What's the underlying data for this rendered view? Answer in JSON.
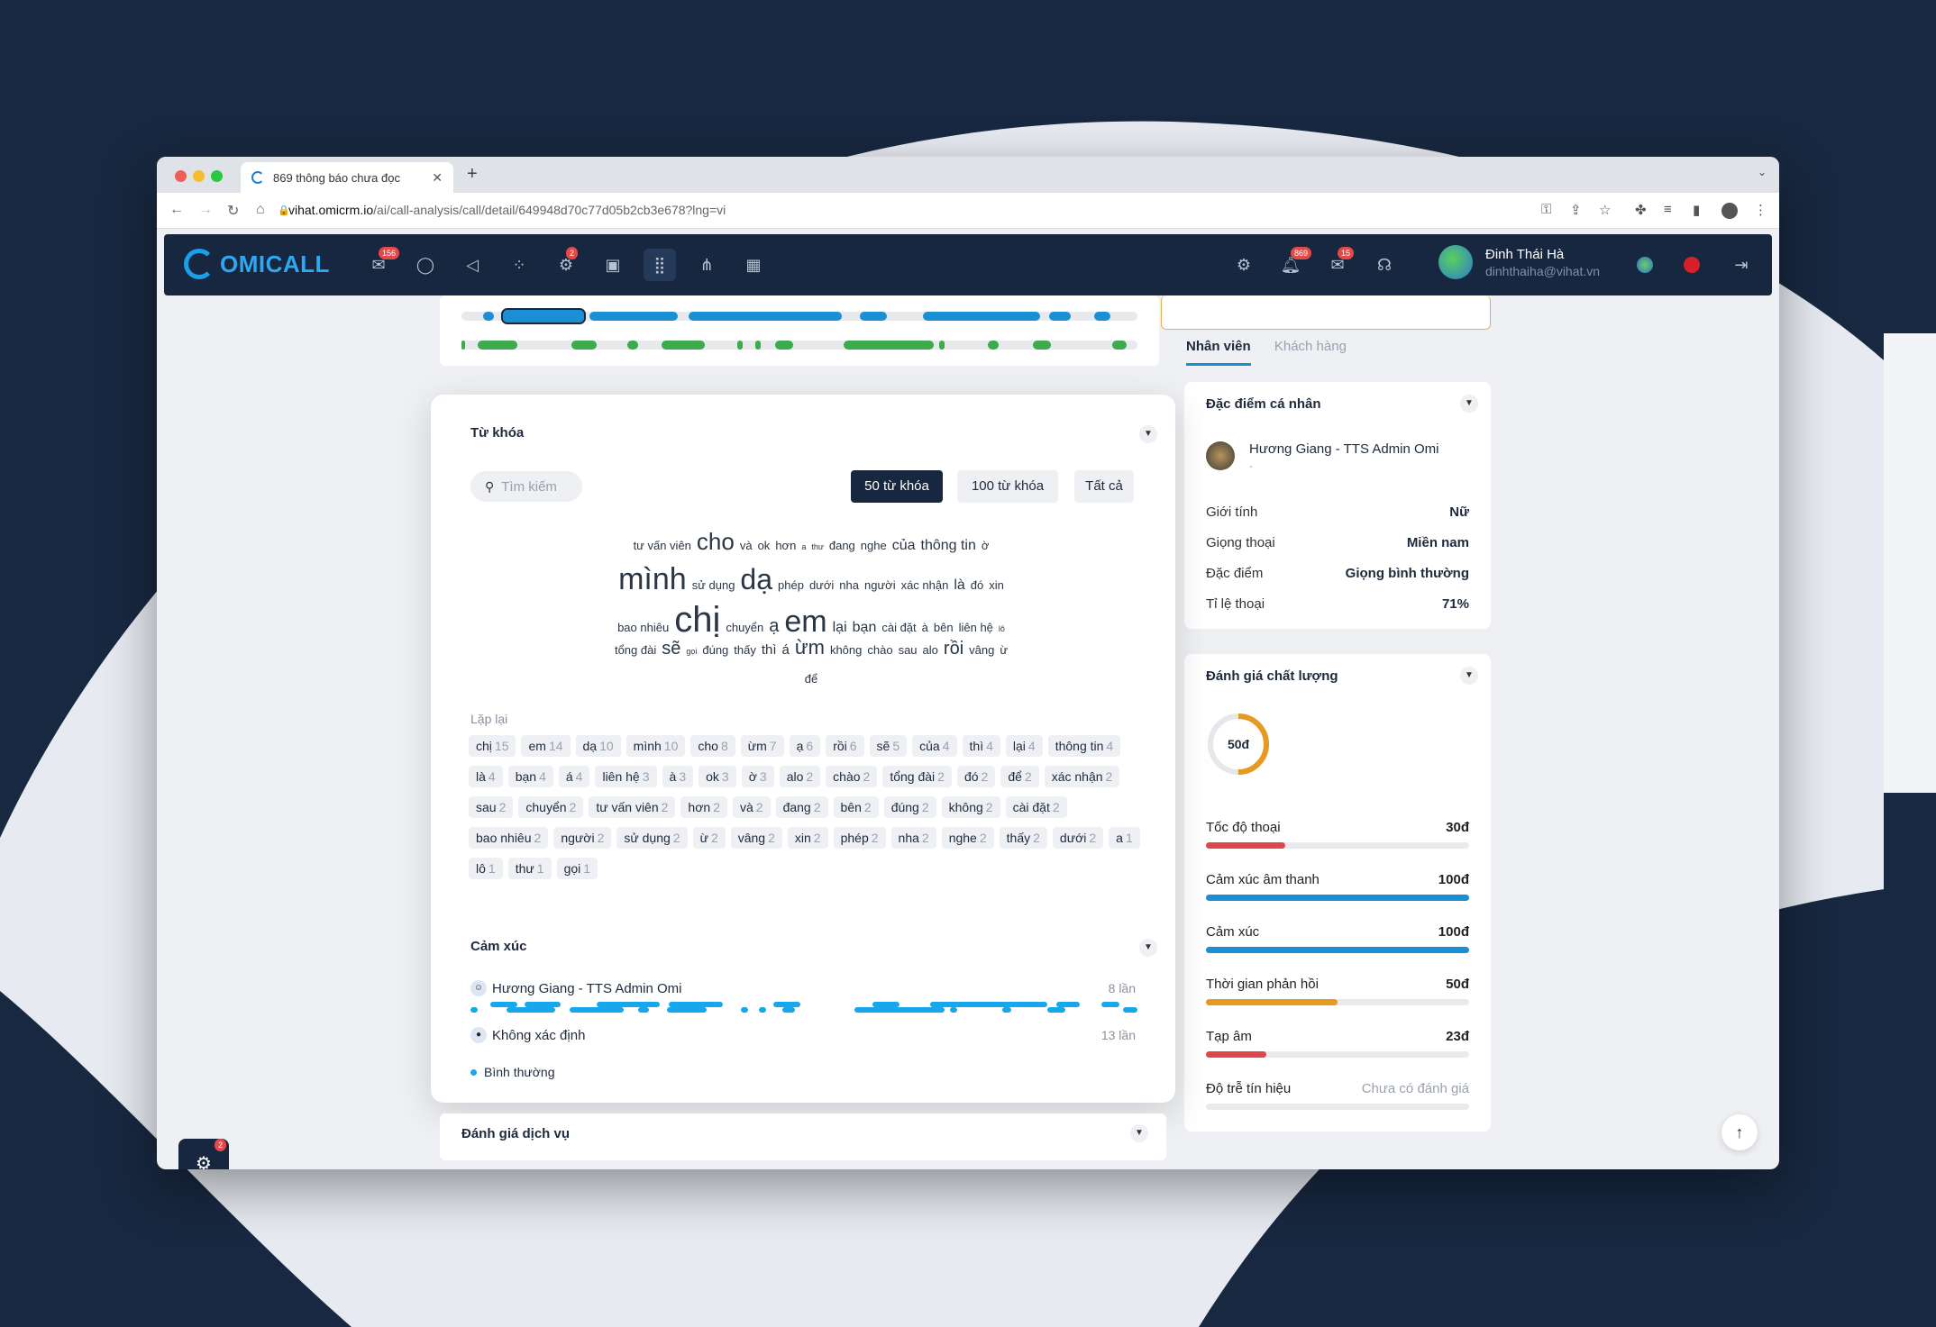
{
  "browser": {
    "tab_title": "869 thông báo chưa đọc",
    "url_host": "vihat.omicrm.io",
    "url_path": "/ai/call-analysis/call/detail/649948d70c77d05b2cb3e678?lng=vi"
  },
  "app": {
    "logo": "OMICALL",
    "badges": {
      "inbox": "156",
      "settings": "2",
      "notifications": "869",
      "mail": "15",
      "support": "2"
    },
    "user_name": "Đinh Thái Hà",
    "user_email": "dinhthaiha@vihat.vn"
  },
  "right": {
    "tabs": [
      "Nhân viên",
      "Khách hàng"
    ],
    "personal_title": "Đặc điểm cá nhân",
    "agent_name": "Hương Giang - TTS Admin Omi",
    "agent_sub": "-",
    "attrs": [
      {
        "k": "Giới tính",
        "v": "Nữ"
      },
      {
        "k": "Giọng thoại",
        "v": "Miền nam"
      },
      {
        "k": "Đặc điểm",
        "v": "Giọng bình thường"
      },
      {
        "k": "Tỉ lệ thoại",
        "v": "71%"
      }
    ],
    "quality_title": "Đánh giá chất lượng",
    "quality_score": "50đ",
    "quality_fraction": 0.5,
    "scores": [
      {
        "k": "Tốc độ thoại",
        "v": "30đ",
        "fill": 0.3,
        "color": "#e0474c"
      },
      {
        "k": "Cảm xúc âm thanh",
        "v": "100đ",
        "fill": 1.0,
        "color": "#1a8fd4"
      },
      {
        "k": "Cảm xúc",
        "v": "100đ",
        "fill": 1.0,
        "color": "#1a8fd4"
      },
      {
        "k": "Thời gian phản hồi",
        "v": "50đ",
        "fill": 0.5,
        "color": "#e59a22"
      },
      {
        "k": "Tạp âm",
        "v": "23đ",
        "fill": 0.23,
        "color": "#e0474c"
      },
      {
        "k": "Độ trễ tín hiệu",
        "v": "Chưa có đánh giá",
        "fill": 0,
        "color": "#e0474c"
      }
    ]
  },
  "keywords": {
    "title": "Từ khóa",
    "search_placeholder": "Tìm kiếm",
    "filters": [
      "50 từ khóa",
      "100 từ khóa",
      "Tất cả"
    ],
    "cloud_lines": [
      [
        [
          "tư vấn viên",
          13
        ],
        [
          "cho",
          26
        ],
        [
          "và",
          13
        ],
        [
          "ok",
          13
        ],
        [
          "hơn",
          13
        ],
        [
          "a",
          9
        ],
        [
          "thư",
          9
        ],
        [
          "đang",
          13
        ],
        [
          "nghe",
          13
        ],
        [
          "của",
          16
        ],
        [
          "thông tin",
          16
        ],
        [
          "ờ",
          13
        ]
      ],
      [
        [
          "mình",
          34
        ],
        [
          "sử dụng",
          13
        ],
        [
          "dạ",
          32
        ],
        [
          "phép",
          13
        ],
        [
          "dưới",
          13
        ],
        [
          "nha",
          13
        ],
        [
          "người",
          13
        ],
        [
          "xác nhận",
          13
        ],
        [
          "là",
          16
        ],
        [
          "đó",
          13
        ],
        [
          "xin",
          13
        ]
      ],
      [
        [
          "bao nhiêu",
          13
        ],
        [
          "chị",
          40
        ],
        [
          "chuyển",
          13
        ],
        [
          "ạ",
          20
        ],
        [
          "em",
          34
        ],
        [
          "lại",
          16
        ],
        [
          "bạn",
          16
        ],
        [
          "cài đặt",
          13
        ],
        [
          "à",
          13
        ],
        [
          "bên",
          13
        ],
        [
          "liên hệ",
          13
        ],
        [
          "lô",
          9
        ]
      ],
      [
        [
          "tổng đài",
          13
        ],
        [
          "sẽ",
          20
        ],
        [
          "gọi",
          9
        ],
        [
          "đúng",
          13
        ],
        [
          "thấy",
          13
        ],
        [
          "thì",
          15
        ],
        [
          "á",
          15
        ],
        [
          "ừm",
          22
        ],
        [
          "không",
          13
        ],
        [
          "chào",
          13
        ],
        [
          "sau",
          13
        ],
        [
          "alo",
          13
        ],
        [
          "rồi",
          20
        ],
        [
          "vâng",
          13
        ],
        [
          "ừ",
          13
        ]
      ],
      [
        [
          "để",
          13
        ]
      ]
    ],
    "repeat_label": "Lặp lại",
    "chips": [
      [
        "chị",
        "15"
      ],
      [
        "em",
        "14"
      ],
      [
        "dạ",
        "10"
      ],
      [
        "mình",
        "10"
      ],
      [
        "cho",
        "8"
      ],
      [
        "ừm",
        "7"
      ],
      [
        "ạ",
        "6"
      ],
      [
        "rồi",
        "6"
      ],
      [
        "sẽ",
        "5"
      ],
      [
        "của",
        "4"
      ],
      [
        "thì",
        "4"
      ],
      [
        "lại",
        "4"
      ],
      [
        "thông tin",
        "4"
      ],
      [
        "là",
        "4"
      ],
      [
        "bạn",
        "4"
      ],
      [
        "á",
        "4"
      ],
      [
        "liên hệ",
        "3"
      ],
      [
        "à",
        "3"
      ],
      [
        "ok",
        "3"
      ],
      [
        "ờ",
        "3"
      ],
      [
        "alo",
        "2"
      ],
      [
        "chào",
        "2"
      ],
      [
        "tổng đài",
        "2"
      ],
      [
        "đó",
        "2"
      ],
      [
        "để",
        "2"
      ],
      [
        "xác nhận",
        "2"
      ],
      [
        "sau",
        "2"
      ],
      [
        "chuyển",
        "2"
      ],
      [
        "tư vấn viên",
        "2"
      ],
      [
        "hơn",
        "2"
      ],
      [
        "và",
        "2"
      ],
      [
        "đang",
        "2"
      ],
      [
        "bên",
        "2"
      ],
      [
        "đúng",
        "2"
      ],
      [
        "không",
        "2"
      ],
      [
        "cài đặt",
        "2"
      ],
      [
        "bao nhiêu",
        "2"
      ],
      [
        "người",
        "2"
      ],
      [
        "sử dụng",
        "2"
      ],
      [
        "ừ",
        "2"
      ],
      [
        "vâng",
        "2"
      ],
      [
        "xin",
        "2"
      ],
      [
        "phép",
        "2"
      ],
      [
        "nha",
        "2"
      ],
      [
        "nghe",
        "2"
      ],
      [
        "thấy",
        "2"
      ],
      [
        "dưới",
        "2"
      ],
      [
        "a",
        "1"
      ],
      [
        "lô",
        "1"
      ],
      [
        "thư",
        "1"
      ],
      [
        "gọi",
        "1"
      ]
    ]
  },
  "emotion": {
    "title": "Cảm xúc",
    "speaker1": "Hương Giang - TTS Admin Omi",
    "speaker1_count": "8 lần",
    "speaker2": "Không xác định",
    "speaker2_count": "13 lần",
    "legend": "Bình thường"
  },
  "service": {
    "title": "Đánh giá dịch vụ"
  }
}
